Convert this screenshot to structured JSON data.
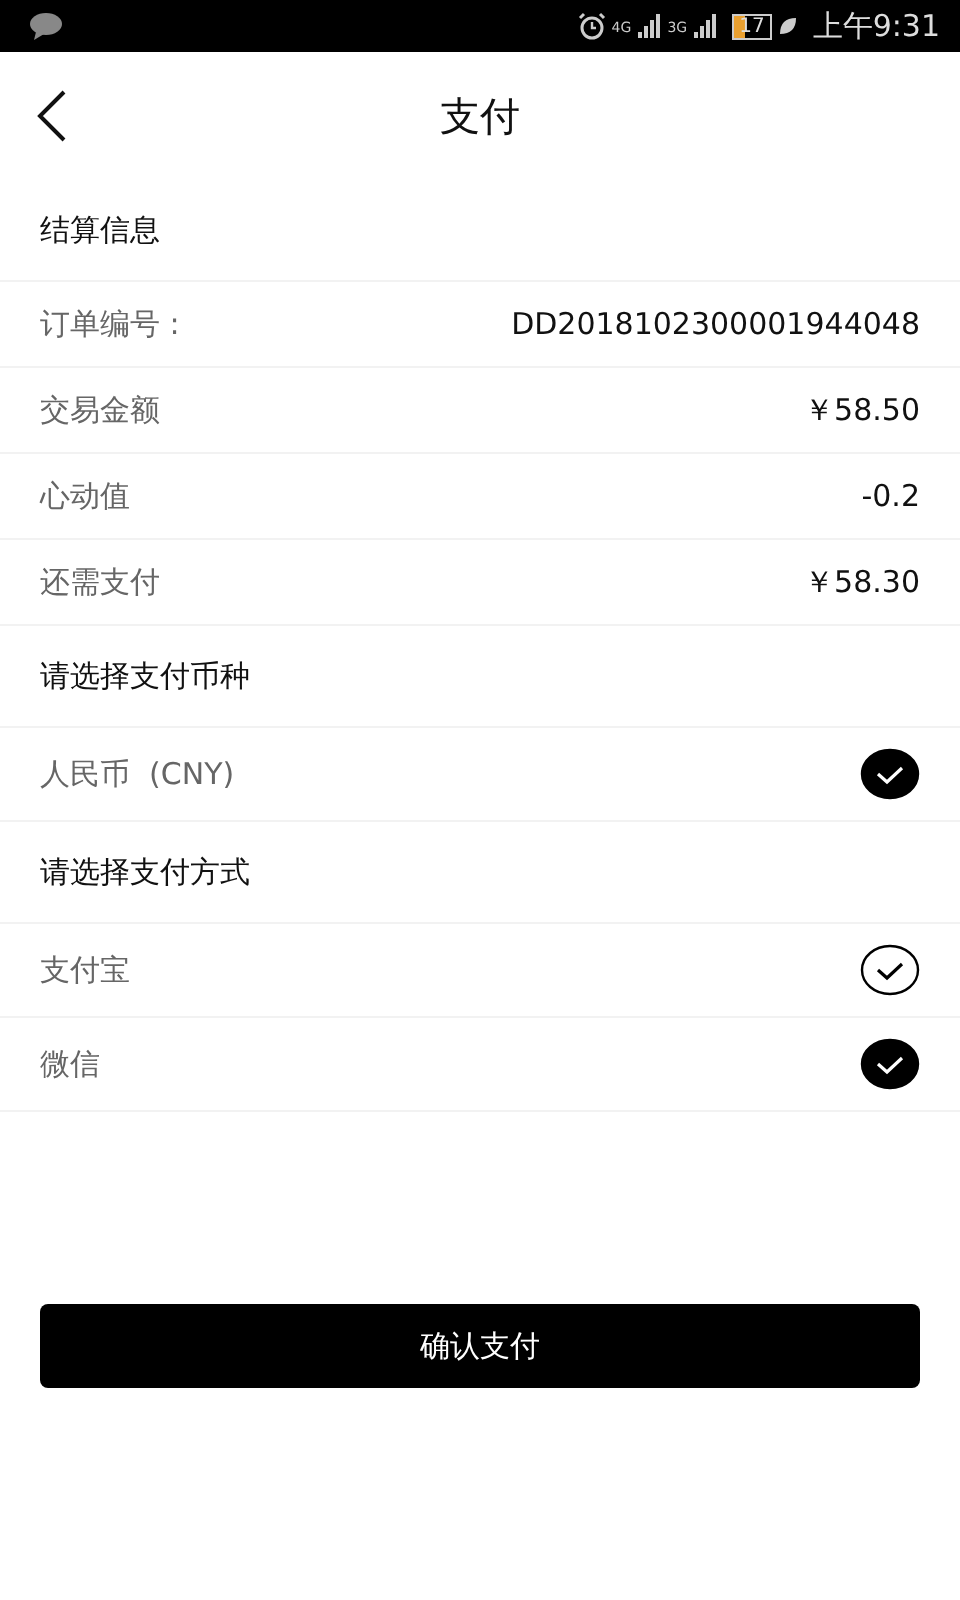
{
  "status_bar": {
    "network_labels": [
      "4G",
      "3G"
    ],
    "battery": "17",
    "time": "上午9:31"
  },
  "header": {
    "title": "支付"
  },
  "sections": [
    {
      "title": "结算信息",
      "rows": [
        {
          "kind": "info",
          "label": "订单编号 :",
          "value": "DD2018102300001944048"
        },
        {
          "kind": "info",
          "label": "交易金额",
          "value": "￥58.50"
        },
        {
          "kind": "info",
          "label": "心动值",
          "value": "-0.2"
        },
        {
          "kind": "info",
          "label": "还需支付",
          "value": "￥58.30"
        }
      ]
    },
    {
      "title": "请选择支付币种",
      "rows": [
        {
          "kind": "option",
          "label": "人民币  (CNY)",
          "selected": true
        }
      ]
    },
    {
      "title": "请选择支付方式",
      "rows": [
        {
          "kind": "option",
          "label": "支付宝",
          "selected": false
        },
        {
          "kind": "option",
          "label": "微信",
          "selected": true
        }
      ]
    }
  ],
  "confirm_button": "确认支付"
}
